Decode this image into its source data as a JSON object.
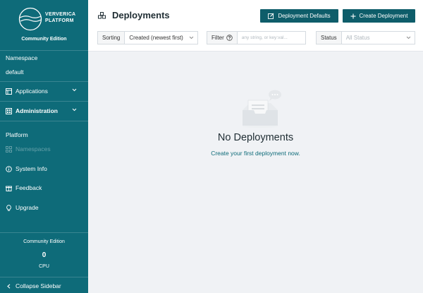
{
  "sidebar": {
    "brand_line1": "VERVERICA",
    "brand_line2": "PLATFORM",
    "edition": "Community Edition",
    "namespace_label": "Namespace",
    "namespace_value": "default",
    "nav": {
      "applications": "Applications",
      "administration": "Administration"
    },
    "platform_label": "Platform",
    "platform_items": {
      "namespaces": "Namespaces",
      "system_info": "System Info",
      "feedback": "Feedback",
      "upgrade": "Upgrade"
    },
    "footer": {
      "edition": "Community Edition",
      "cpu_count": "0",
      "cpu_label": "CPU",
      "collapse": "Collapse Sidebar"
    }
  },
  "header": {
    "title": "Deployments",
    "defaults_button": "Deployment Defaults",
    "create_button": "Create Deployment"
  },
  "filters": {
    "sorting_label": "Sorting",
    "sorting_value": "Created (newest first)",
    "filter_label": "Filter",
    "filter_placeholder": "any string, or key:val...",
    "status_label": "Status",
    "status_value": "All Status"
  },
  "empty_state": {
    "title": "No Deployments",
    "link": "Create your first deployment now."
  },
  "colors": {
    "sidebar": "#0e6b79",
    "button": "#0e5d6a",
    "link": "#0e6b79"
  }
}
